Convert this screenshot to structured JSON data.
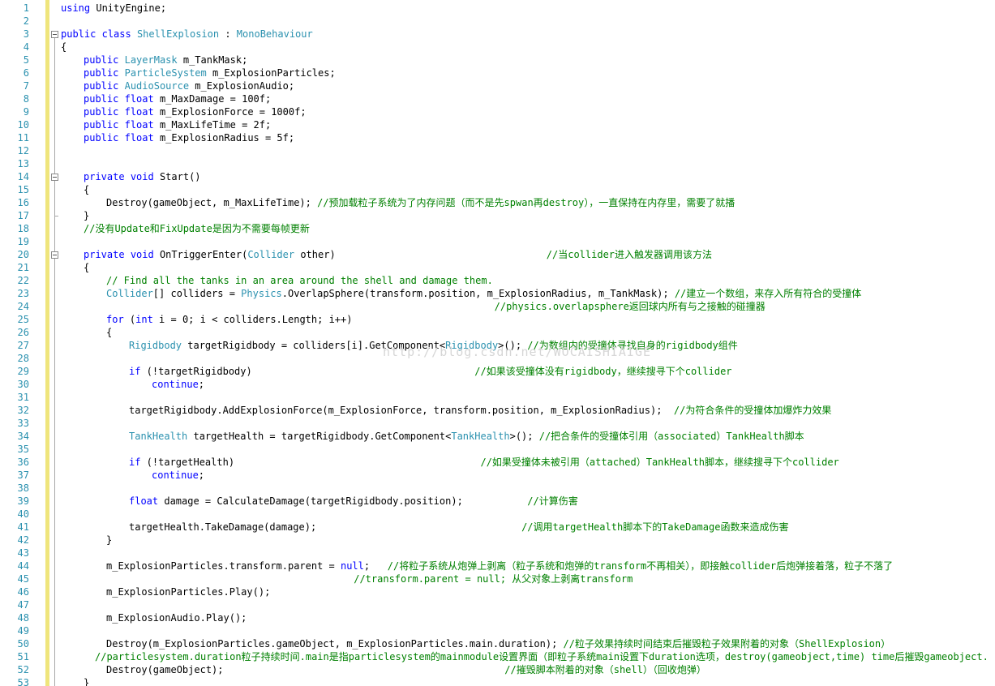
{
  "editor": {
    "watermark": "http://blog.csdn.net/WOCAISHIAIGE",
    "colors": {
      "keyword": "#0000ff",
      "type": "#2b91af",
      "comment": "#008000",
      "line_number": "#2b91af",
      "change_bar": "#efe57c"
    },
    "lines": [
      {
        "n": "1",
        "indent": 0,
        "tokens": [
          {
            "t": "kw",
            "v": "using"
          },
          {
            "t": "pl",
            "v": " UnityEngine;"
          }
        ]
      },
      {
        "n": "2",
        "indent": 0,
        "tokens": []
      },
      {
        "n": "3",
        "indent": 0,
        "tokens": [
          {
            "t": "kw",
            "v": "public"
          },
          {
            "t": "pl",
            "v": " "
          },
          {
            "t": "kw",
            "v": "class"
          },
          {
            "t": "pl",
            "v": " "
          },
          {
            "t": "ty",
            "v": "ShellExplosion"
          },
          {
            "t": "pl",
            "v": " : "
          },
          {
            "t": "ty",
            "v": "MonoBehaviour"
          }
        ]
      },
      {
        "n": "4",
        "indent": 0,
        "tokens": [
          {
            "t": "pl",
            "v": "{"
          }
        ]
      },
      {
        "n": "5",
        "indent": 4,
        "tokens": [
          {
            "t": "kw",
            "v": "public"
          },
          {
            "t": "pl",
            "v": " "
          },
          {
            "t": "ty",
            "v": "LayerMask"
          },
          {
            "t": "pl",
            "v": " m_TankMask;"
          }
        ]
      },
      {
        "n": "6",
        "indent": 4,
        "tokens": [
          {
            "t": "kw",
            "v": "public"
          },
          {
            "t": "pl",
            "v": " "
          },
          {
            "t": "ty",
            "v": "ParticleSystem"
          },
          {
            "t": "pl",
            "v": " m_ExplosionParticles;"
          }
        ]
      },
      {
        "n": "7",
        "indent": 4,
        "tokens": [
          {
            "t": "kw",
            "v": "public"
          },
          {
            "t": "pl",
            "v": " "
          },
          {
            "t": "ty",
            "v": "AudioSource"
          },
          {
            "t": "pl",
            "v": " m_ExplosionAudio;"
          }
        ]
      },
      {
        "n": "8",
        "indent": 4,
        "tokens": [
          {
            "t": "kw",
            "v": "public"
          },
          {
            "t": "pl",
            "v": " "
          },
          {
            "t": "kw",
            "v": "float"
          },
          {
            "t": "pl",
            "v": " m_MaxDamage = 100f;"
          }
        ]
      },
      {
        "n": "9",
        "indent": 4,
        "tokens": [
          {
            "t": "kw",
            "v": "public"
          },
          {
            "t": "pl",
            "v": " "
          },
          {
            "t": "kw",
            "v": "float"
          },
          {
            "t": "pl",
            "v": " m_ExplosionForce = 1000f;"
          }
        ]
      },
      {
        "n": "10",
        "indent": 4,
        "tokens": [
          {
            "t": "kw",
            "v": "public"
          },
          {
            "t": "pl",
            "v": " "
          },
          {
            "t": "kw",
            "v": "float"
          },
          {
            "t": "pl",
            "v": " m_MaxLifeTime = 2f;"
          }
        ]
      },
      {
        "n": "11",
        "indent": 4,
        "tokens": [
          {
            "t": "kw",
            "v": "public"
          },
          {
            "t": "pl",
            "v": " "
          },
          {
            "t": "kw",
            "v": "float"
          },
          {
            "t": "pl",
            "v": " m_ExplosionRadius = 5f;"
          }
        ]
      },
      {
        "n": "12",
        "indent": 0,
        "tokens": []
      },
      {
        "n": "13",
        "indent": 0,
        "tokens": []
      },
      {
        "n": "14",
        "indent": 4,
        "tokens": [
          {
            "t": "kw",
            "v": "private"
          },
          {
            "t": "pl",
            "v": " "
          },
          {
            "t": "kw",
            "v": "void"
          },
          {
            "t": "pl",
            "v": " Start()"
          }
        ]
      },
      {
        "n": "15",
        "indent": 4,
        "tokens": [
          {
            "t": "pl",
            "v": "{"
          }
        ]
      },
      {
        "n": "16",
        "indent": 8,
        "tokens": [
          {
            "t": "pl",
            "v": "Destroy(gameObject, m_MaxLifeTime); "
          },
          {
            "t": "cm",
            "v": "//预加载粒子系统为了内存问题（而不是先spwan再destroy），一直保持在内存里，需要了就播"
          }
        ]
      },
      {
        "n": "17",
        "indent": 4,
        "tokens": [
          {
            "t": "pl",
            "v": "}"
          }
        ]
      },
      {
        "n": "18",
        "indent": 4,
        "tokens": [
          {
            "t": "cm",
            "v": "//没有Update和FixUpdate是因为不需要每帧更新"
          }
        ]
      },
      {
        "n": "19",
        "indent": 0,
        "tokens": []
      },
      {
        "n": "20",
        "indent": 4,
        "tokens": [
          {
            "t": "kw",
            "v": "private"
          },
          {
            "t": "pl",
            "v": " "
          },
          {
            "t": "kw",
            "v": "void"
          },
          {
            "t": "pl",
            "v": " OnTriggerEnter("
          },
          {
            "t": "ty",
            "v": "Collider"
          },
          {
            "t": "pl",
            "v": " other)                                    "
          },
          {
            "t": "cm",
            "v": "//当collider进入触发器调用该方法"
          }
        ]
      },
      {
        "n": "21",
        "indent": 4,
        "tokens": [
          {
            "t": "pl",
            "v": "{"
          }
        ]
      },
      {
        "n": "22",
        "indent": 8,
        "tokens": [
          {
            "t": "cm",
            "v": "// Find all the tanks in an area around the shell and damage them."
          }
        ]
      },
      {
        "n": "23",
        "indent": 8,
        "tokens": [
          {
            "t": "ty",
            "v": "Collider"
          },
          {
            "t": "pl",
            "v": "[] colliders = "
          },
          {
            "t": "ty",
            "v": "Physics"
          },
          {
            "t": "pl",
            "v": ".OverlapSphere(transform.position, m_ExplosionRadius, m_TankMask); "
          },
          {
            "t": "cm",
            "v": "//建立一个数组，来存入所有符合的受撞体"
          }
        ]
      },
      {
        "n": "24",
        "indent": 0,
        "tokens": [
          {
            "t": "pl",
            "v": "                                                                          "
          },
          {
            "t": "cm",
            "v": "//physics.overlapsphere返回球内所有与之接触的碰撞器"
          }
        ]
      },
      {
        "n": "25",
        "indent": 8,
        "tokens": [
          {
            "t": "kw",
            "v": "for"
          },
          {
            "t": "pl",
            "v": " ("
          },
          {
            "t": "kw",
            "v": "int"
          },
          {
            "t": "pl",
            "v": " i = 0; i < colliders.Length; i++)"
          }
        ]
      },
      {
        "n": "26",
        "indent": 8,
        "tokens": [
          {
            "t": "pl",
            "v": "{"
          }
        ]
      },
      {
        "n": "27",
        "indent": 12,
        "tokens": [
          {
            "t": "ty",
            "v": "Rigidbody"
          },
          {
            "t": "pl",
            "v": " targetRigidbody = colliders[i].GetComponent<"
          },
          {
            "t": "ty",
            "v": "Rigidbody"
          },
          {
            "t": "pl",
            "v": ">(); "
          },
          {
            "t": "cm",
            "v": "//为数组内的受撞体寻找自身的rigidbody组件"
          }
        ]
      },
      {
        "n": "28",
        "indent": 0,
        "tokens": []
      },
      {
        "n": "29",
        "indent": 12,
        "tokens": [
          {
            "t": "kw",
            "v": "if"
          },
          {
            "t": "pl",
            "v": " (!targetRigidbody)                                      "
          },
          {
            "t": "cm",
            "v": "//如果该受撞体没有rigidbody，继续搜寻下个collider"
          }
        ]
      },
      {
        "n": "30",
        "indent": 16,
        "tokens": [
          {
            "t": "kw",
            "v": "continue"
          },
          {
            "t": "pl",
            "v": ";"
          }
        ]
      },
      {
        "n": "31",
        "indent": 0,
        "tokens": []
      },
      {
        "n": "32",
        "indent": 12,
        "tokens": [
          {
            "t": "pl",
            "v": "targetRigidbody.AddExplosionForce(m_ExplosionForce, transform.position, m_ExplosionRadius);  "
          },
          {
            "t": "cm",
            "v": "//为符合条件的受撞体加爆炸力效果"
          }
        ]
      },
      {
        "n": "33",
        "indent": 0,
        "tokens": []
      },
      {
        "n": "34",
        "indent": 12,
        "tokens": [
          {
            "t": "ty",
            "v": "TankHealth"
          },
          {
            "t": "pl",
            "v": " targetHealth = targetRigidbody.GetComponent<"
          },
          {
            "t": "ty",
            "v": "TankHealth"
          },
          {
            "t": "pl",
            "v": ">(); "
          },
          {
            "t": "cm",
            "v": "//把合条件的受撞体引用（associated）TankHealth脚本"
          }
        ]
      },
      {
        "n": "35",
        "indent": 0,
        "tokens": []
      },
      {
        "n": "36",
        "indent": 12,
        "tokens": [
          {
            "t": "kw",
            "v": "if"
          },
          {
            "t": "pl",
            "v": " (!targetHealth)                                          "
          },
          {
            "t": "cm",
            "v": "//如果受撞体未被引用（attached）TankHealth脚本，继续搜寻下个collider"
          }
        ]
      },
      {
        "n": "37",
        "indent": 16,
        "tokens": [
          {
            "t": "kw",
            "v": "continue"
          },
          {
            "t": "pl",
            "v": ";"
          }
        ]
      },
      {
        "n": "38",
        "indent": 0,
        "tokens": []
      },
      {
        "n": "39",
        "indent": 12,
        "tokens": [
          {
            "t": "kw",
            "v": "float"
          },
          {
            "t": "pl",
            "v": " damage = CalculateDamage(targetRigidbody.position);           "
          },
          {
            "t": "cm",
            "v": "//计算伤害"
          }
        ]
      },
      {
        "n": "40",
        "indent": 0,
        "tokens": []
      },
      {
        "n": "41",
        "indent": 12,
        "tokens": [
          {
            "t": "pl",
            "v": "targetHealth.TakeDamage(damage);                                   "
          },
          {
            "t": "cm",
            "v": "//调用targetHealth脚本下的TakeDamage函数来造成伤害"
          }
        ]
      },
      {
        "n": "42",
        "indent": 8,
        "tokens": [
          {
            "t": "pl",
            "v": "}"
          }
        ]
      },
      {
        "n": "43",
        "indent": 0,
        "tokens": []
      },
      {
        "n": "44",
        "indent": 8,
        "tokens": [
          {
            "t": "pl",
            "v": "m_ExplosionParticles.transform.parent = "
          },
          {
            "t": "kw",
            "v": "null"
          },
          {
            "t": "pl",
            "v": ";   "
          },
          {
            "t": "cm",
            "v": "//将粒子系统从炮弹上剥离（粒子系统和炮弹的transform不再相关），即接触collider后炮弹接着落，粒子不落了"
          }
        ]
      },
      {
        "n": "45",
        "indent": 0,
        "tokens": [
          {
            "t": "pl",
            "v": "                                                  "
          },
          {
            "t": "cm",
            "v": "//transform.parent = null; 从父对象上剥离transform"
          }
        ]
      },
      {
        "n": "46",
        "indent": 8,
        "tokens": [
          {
            "t": "pl",
            "v": "m_ExplosionParticles.Play();"
          }
        ]
      },
      {
        "n": "47",
        "indent": 0,
        "tokens": []
      },
      {
        "n": "48",
        "indent": 8,
        "tokens": [
          {
            "t": "pl",
            "v": "m_ExplosionAudio.Play();"
          }
        ]
      },
      {
        "n": "49",
        "indent": 0,
        "tokens": []
      },
      {
        "n": "50",
        "indent": 8,
        "tokens": [
          {
            "t": "pl",
            "v": "Destroy(m_ExplosionParticles.gameObject, m_ExplosionParticles.main.duration); "
          },
          {
            "t": "cm",
            "v": "//粒子效果持续时间结束后摧毁粒子效果附着的对象（ShellExplosion）"
          }
        ]
      },
      {
        "n": "51",
        "indent": 6,
        "tokens": [
          {
            "t": "cm",
            "v": "//particlesystem.duration粒子持续时间.main是指particlesystem的mainmodule设置界面（即粒子系统main设置下duration选项，destroy(gameobject,time) time后摧毁gameobject."
          }
        ]
      },
      {
        "n": "52",
        "indent": 8,
        "tokens": [
          {
            "t": "pl",
            "v": "Destroy(gameObject);                                                "
          },
          {
            "t": "cm",
            "v": "//摧毁脚本附着的对象（shell）（回收炮弹）"
          }
        ]
      },
      {
        "n": "53",
        "indent": 4,
        "tokens": [
          {
            "t": "pl",
            "v": "}"
          }
        ]
      }
    ]
  }
}
